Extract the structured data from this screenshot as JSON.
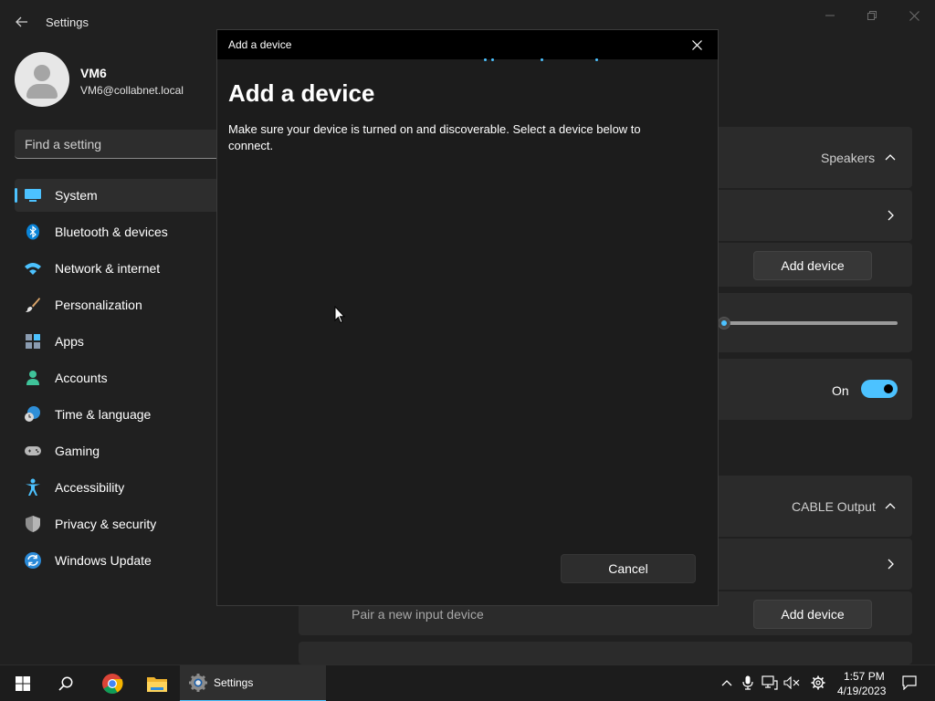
{
  "window": {
    "title": "Settings"
  },
  "user": {
    "name": "VM6",
    "email": "VM6@collabnet.local"
  },
  "search": {
    "placeholder": "Find a setting"
  },
  "sidebar": {
    "items": [
      {
        "label": "System",
        "icon": "system-icon",
        "active": true
      },
      {
        "label": "Bluetooth & devices",
        "icon": "bluetooth-icon"
      },
      {
        "label": "Network & internet",
        "icon": "wifi-icon"
      },
      {
        "label": "Personalization",
        "icon": "brush-icon"
      },
      {
        "label": "Apps",
        "icon": "apps-icon"
      },
      {
        "label": "Accounts",
        "icon": "person-icon"
      },
      {
        "label": "Time & language",
        "icon": "clock-globe-icon"
      },
      {
        "label": "Gaming",
        "icon": "gamepad-icon"
      },
      {
        "label": "Accessibility",
        "icon": "accessibility-icon"
      },
      {
        "label": "Privacy & security",
        "icon": "shield-icon"
      },
      {
        "label": "Windows Update",
        "icon": "update-icon"
      }
    ]
  },
  "panel": {
    "output_device": "Speakers",
    "add_device_label": "Add device",
    "toggle_label": "On",
    "volume_fraction": 0.0,
    "input_device": "CABLE Output",
    "pair_input_label": "Pair a new input device",
    "add_input_device_label": "Add device"
  },
  "dialog": {
    "titlebar": "Add a device",
    "heading": "Add a device",
    "description": "Make sure your device is turned on and discoverable. Select a device below to connect.",
    "cancel_label": "Cancel"
  },
  "taskbar": {
    "settings_label": "Settings",
    "time": "1:57 PM",
    "date": "4/19/2023"
  },
  "colors": {
    "accent": "#4cc2ff",
    "background": "#202020",
    "card": "#2b2b2b",
    "dialog_bg": "#1c1c1c"
  }
}
